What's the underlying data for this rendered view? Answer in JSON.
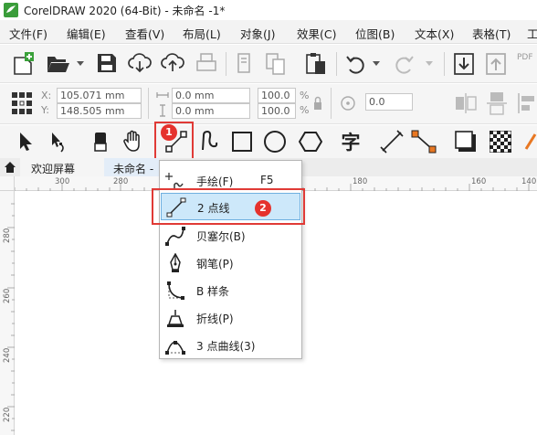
{
  "app": {
    "title": "CorelDRAW 2020 (64-Bit) - 未命名 -1*"
  },
  "menu": [
    "文件(F)",
    "编辑(E)",
    "查看(V)",
    "布局(L)",
    "对象(J)",
    "效果(C)",
    "位图(B)",
    "文本(X)",
    "表格(T)",
    "工"
  ],
  "toolbar": {
    "pdf_label": "PDF"
  },
  "properties": {
    "x_label": "X:",
    "y_label": "Y:",
    "x_value": "105.071 mm",
    "y_value": "148.505 mm",
    "width_value": "0.0 mm",
    "height_value": "0.0 mm",
    "scale_x": "100.0",
    "scale_y": "100.0",
    "percent": "%",
    "rotation": "0.0"
  },
  "toolbox": {
    "text_tool_glyph": "字"
  },
  "tabs": {
    "welcome": "欢迎屏幕",
    "document": "未命名 -"
  },
  "ruler": {
    "top": [
      "300",
      "280",
      "180",
      "160",
      "140"
    ],
    "left": [
      "280",
      "260",
      "240",
      "220"
    ]
  },
  "flyout": {
    "items": [
      {
        "label": "手绘(F)",
        "shortcut": "F5"
      },
      {
        "label": "2 点线",
        "shortcut": ""
      },
      {
        "label": "贝塞尔(B)",
        "shortcut": ""
      },
      {
        "label": "钢笔(P)",
        "shortcut": ""
      },
      {
        "label": "B 样条",
        "shortcut": ""
      },
      {
        "label": "折线(P)",
        "shortcut": ""
      },
      {
        "label": "3 点曲线(3)",
        "shortcut": ""
      }
    ]
  },
  "annotations": {
    "step1": "1",
    "step2": "2"
  },
  "colors": {
    "accent_red": "#e03a36",
    "highlight": "#cde8fa",
    "highlight_border": "#6fb0e0"
  }
}
